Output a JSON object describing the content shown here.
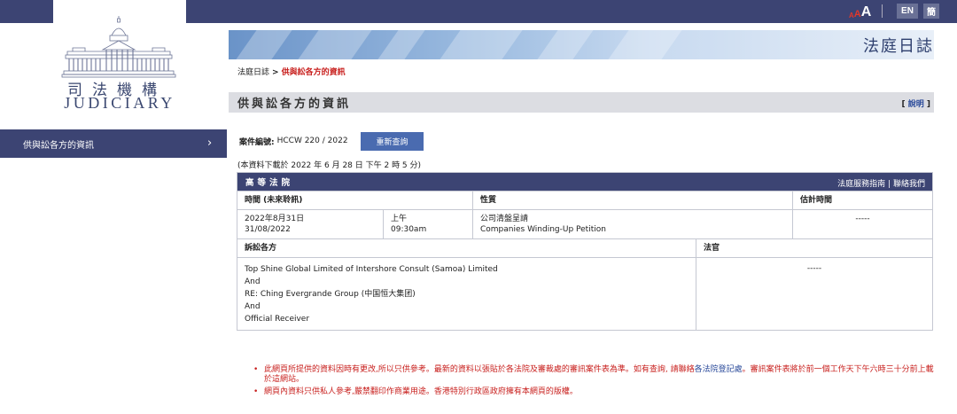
{
  "topbar": {
    "font_size_small": "A",
    "font_size_medium": "A",
    "font_size_large": "A",
    "lang_en": "EN",
    "lang_zh": "簡"
  },
  "logo": {
    "cn": "司法機構",
    "en": "JUDICIARY"
  },
  "sidebar": {
    "items": [
      {
        "label": "供與訟各方的資訊",
        "chevron": "›"
      }
    ]
  },
  "banner": {
    "title": "法庭日誌"
  },
  "breadcrumb": {
    "home": "法庭日誌",
    "separator": ">",
    "current": "供與訟各方的資訊"
  },
  "section": {
    "title": "供與訟各方的資訊",
    "help": "說明"
  },
  "case": {
    "label": "案件編號:",
    "number": "HCCW 220 / 2022",
    "requery_label": "重新查詢",
    "download_note": "(本資料下載於 2022 年 6 月 28 日 下午 2 時 5 分)"
  },
  "table": {
    "court": "高等法院",
    "links": {
      "guide": "法庭服務指南",
      "sep": "|",
      "contact": "聯絡我們"
    },
    "headers": {
      "time": "時間 (未來聆訊)",
      "nature": "性質",
      "est": "估計時間"
    },
    "hearing": {
      "date_cn": "2022年8月31日",
      "date_en": "31/08/2022",
      "ampm_cn": "上午",
      "time": "09:30am",
      "nature_cn": "公司清盤呈請",
      "nature_en": "Companies Winding-Up Petition",
      "est": "-----"
    },
    "parties_header": "訴訟各方",
    "judge_header": "法官",
    "parties": [
      "Top Shine Global Limited of Intershore Consult (Samoa) Limited",
      "And",
      "RE: Ching Evergrande Group (中国恒大集团)",
      "And",
      "Official Receiver"
    ],
    "judge": "-----"
  },
  "notes": [
    {
      "pre": "此網頁所提供的資料因時有更改,所以只供參考。最新的資料以張貼於各法院及審裁處的審訊案件表為準。如有查詢, 請聯絡",
      "link": "各法院登記處",
      "post": "。審訊案件表將於前一個工作天下午六時三十分前上載於這網站。"
    },
    {
      "pre": "網頁內資料只供私人參考,嚴禁翻印作商業用途。香港特別行政區政府擁有本網頁的版權。"
    }
  ],
  "colors": {
    "navy": "#3c4473",
    "red": "#c8201e",
    "button": "#4a6bb0"
  }
}
